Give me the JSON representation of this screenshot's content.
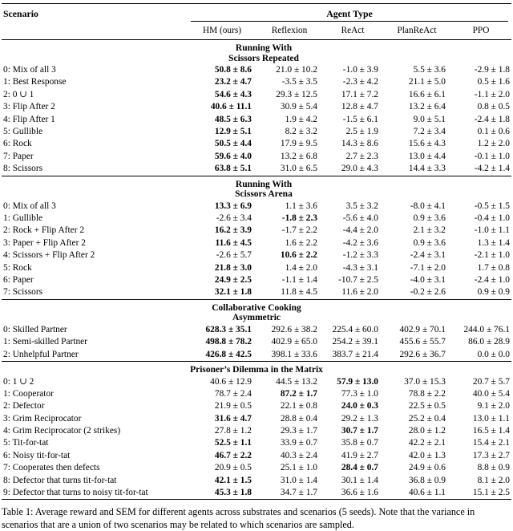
{
  "table": {
    "header": {
      "scenario_label": "Scenario",
      "group_label": "Agent Type",
      "columns": [
        "HM (ours)",
        "Reflexion",
        "ReAct",
        "PlanReAct",
        "PPO"
      ]
    },
    "sections": [
      {
        "title_line1": "Running With",
        "title_line2": "Scissors Repeated",
        "rows": [
          {
            "label": "0: Mix of all 3",
            "values": [
              "50.8 ± 8.6",
              "21.0 ± 10.2",
              "-1.0 ± 3.9",
              "5.5 ± 3.6",
              "-2.9 ± 1.8"
            ],
            "bold": [
              true,
              false,
              false,
              false,
              false
            ]
          },
          {
            "label": "1: Best Response",
            "values": [
              "23.2 ± 4.7",
              "-3.5 ± 3.5",
              "-2.3 ± 4.2",
              "21.1 ± 5.0",
              "0.5 ± 1.6"
            ],
            "bold": [
              true,
              false,
              false,
              false,
              false
            ]
          },
          {
            "label": "2: 0 ∪ 1",
            "values": [
              "54.6 ± 4.3",
              "29.3 ± 12.5",
              "17.1 ± 7.2",
              "16.6 ± 6.1",
              "-1.1 ± 2.0"
            ],
            "bold": [
              true,
              false,
              false,
              false,
              false
            ]
          },
          {
            "label": "3: Flip After 2",
            "values": [
              "40.6 ± 11.1",
              "30.9 ± 5.4",
              "12.8 ± 4.7",
              "13.2 ± 6.4",
              "0.8 ± 0.5"
            ],
            "bold": [
              true,
              false,
              false,
              false,
              false
            ]
          },
          {
            "label": "4: Flip After 1",
            "values": [
              "48.5 ± 6.3",
              "1.9 ± 4.2",
              "-1.5 ± 6.1",
              "9.0 ± 5.1",
              "-2.4 ± 1.8"
            ],
            "bold": [
              true,
              false,
              false,
              false,
              false
            ]
          },
          {
            "label": "5: Gullible",
            "values": [
              "12.9 ± 5.1",
              "8.2 ± 3.2",
              "2.5 ± 1.9",
              "7.2 ± 3.4",
              "0.1 ± 0.6"
            ],
            "bold": [
              true,
              false,
              false,
              false,
              false
            ]
          },
          {
            "label": "6: Rock",
            "values": [
              "50.5 ± 4.4",
              "17.9 ± 9.5",
              "14.3 ± 8.6",
              "15.6 ± 4.3",
              "1.2 ± 2.0"
            ],
            "bold": [
              true,
              false,
              false,
              false,
              false
            ]
          },
          {
            "label": "7: Paper",
            "values": [
              "59.6 ± 4.0",
              "13.2 ± 6.8",
              "2.7 ± 2.3",
              "13.0 ± 4.4",
              "-0.1 ± 1.0"
            ],
            "bold": [
              true,
              false,
              false,
              false,
              false
            ]
          },
          {
            "label": "8: Scissors",
            "values": [
              "63.8 ± 5.1",
              "31.0 ± 6.5",
              "29.0 ± 4.3",
              "14.4 ± 3.3",
              "-4.2 ± 1.4"
            ],
            "bold": [
              true,
              false,
              false,
              false,
              false
            ]
          }
        ]
      },
      {
        "title_line1": "Running With",
        "title_line2": "Scissors Arena",
        "rows": [
          {
            "label": "0: Mix of all 3",
            "values": [
              "13.3 ± 6.9",
              "1.1 ± 3.6",
              "3.5 ± 3.2",
              "-8.0 ± 4.1",
              "-0.5 ± 1.5"
            ],
            "bold": [
              true,
              false,
              false,
              false,
              false
            ]
          },
          {
            "label": "1: Gullible",
            "values": [
              "-2.6 ± 3.4",
              "-1.8 ± 2.3",
              "-5.6 ± 4.0",
              "0.9 ± 3.6",
              "-0.4 ± 1.0"
            ],
            "bold": [
              false,
              true,
              false,
              false,
              false
            ]
          },
          {
            "label": "2: Rock + Flip After 2",
            "values": [
              "16.2 ± 3.9",
              "-1.7 ± 2.2",
              "-4.4 ± 2.0",
              "2.1 ± 3.2",
              "-1.0 ± 1.1"
            ],
            "bold": [
              true,
              false,
              false,
              false,
              false
            ]
          },
          {
            "label": "3: Paper + Flip After 2",
            "values": [
              "11.6 ± 4.5",
              "1.6 ± 2.2",
              "-4.2 ± 3.6",
              "0.9 ± 3.6",
              "1.3 ± 1.4"
            ],
            "bold": [
              true,
              false,
              false,
              false,
              false
            ]
          },
          {
            "label": "4: Scissors + Flip After 2",
            "values": [
              "-2.6 ± 5.7",
              "10.6 ± 2.2",
              "-1.2 ± 3.3",
              "-2.4 ± 3.1",
              "-2.1 ± 1.0"
            ],
            "bold": [
              false,
              true,
              false,
              false,
              false
            ]
          },
          {
            "label": "5: Rock",
            "values": [
              "21.8 ± 3.0",
              "1.4 ± 2.0",
              "-4.3 ± 3.1",
              "-7.1 ± 2.0",
              "1.7 ± 0.8"
            ],
            "bold": [
              true,
              false,
              false,
              false,
              false
            ]
          },
          {
            "label": "6: Paper",
            "values": [
              "24.9 ± 2.5",
              "-1.1 ± 1.4",
              "-10.7 ± 2.5",
              "-4.0 ± 3.1",
              "-2.4 ± 1.0"
            ],
            "bold": [
              true,
              false,
              false,
              false,
              false
            ]
          },
          {
            "label": "7: Scissors",
            "values": [
              "32.1 ± 1.8",
              "11.8 ± 4.5",
              "11.6 ± 2.0",
              "-0.2 ± 2.6",
              "0.9 ± 0.9"
            ],
            "bold": [
              true,
              false,
              false,
              false,
              false
            ]
          }
        ]
      },
      {
        "title_line1": "Collaborative Cooking",
        "title_line2": "Asymmetric",
        "rows": [
          {
            "label": "0: Skilled Partner",
            "values": [
              "628.3 ± 35.1",
              "292.6 ± 38.2",
              "225.4 ± 60.0",
              "402.9 ± 70.1",
              "244.0 ± 76.1"
            ],
            "bold": [
              true,
              false,
              false,
              false,
              false
            ]
          },
          {
            "label": "1: Semi-skilled Partner",
            "values": [
              "498.8 ± 78.2",
              "402.9 ± 65.0",
              "254.2 ± 39.1",
              "455.6 ± 55.7",
              "86.0 ± 28.9"
            ],
            "bold": [
              true,
              false,
              false,
              false,
              false
            ]
          },
          {
            "label": "2: Unhelpful Partner",
            "values": [
              "426.8 ± 42.5",
              "398.1 ± 33.6",
              "383.7 ± 21.4",
              "292.6 ± 36.7",
              "0.0 ± 0.0"
            ],
            "bold": [
              true,
              false,
              false,
              false,
              false
            ]
          }
        ]
      },
      {
        "title_line1": "Prisoner’s Dilemma in the Matrix",
        "title_line2": "",
        "rows": [
          {
            "label": "0: 1 ∪ 2",
            "values": [
              "40.6 ± 12.9",
              "44.5 ± 13.2",
              "57.9 ± 13.0",
              "37.0 ± 15.3",
              "20.7 ± 5.7"
            ],
            "bold": [
              false,
              false,
              true,
              false,
              false
            ]
          },
          {
            "label": "1: Cooperator",
            "values": [
              "78.7 ± 2.4",
              "87.2 ± 1.7",
              "77.3 ± 1.0",
              "78.8 ± 2.2",
              "40.0 ± 5.4"
            ],
            "bold": [
              false,
              true,
              false,
              false,
              false
            ]
          },
          {
            "label": "2: Defector",
            "values": [
              "21.9 ± 0.5",
              "22.1 ± 0.8",
              "24.0 ± 0.3",
              "22.5 ± 0.5",
              "9.1 ± 2.0"
            ],
            "bold": [
              false,
              false,
              true,
              false,
              false
            ]
          },
          {
            "label": "3: Grim Reciprocator",
            "values": [
              "31.6 ± 4.7",
              "28.8 ± 0.4",
              "29.2 ± 1.3",
              "25.2 ± 0.4",
              "13.0 ± 1.1"
            ],
            "bold": [
              true,
              false,
              false,
              false,
              false
            ]
          },
          {
            "label": "4: Grim Reciprocator (2 strikes)",
            "values": [
              "27.8 ± 1.2",
              "29.3 ± 1.7",
              "30.7 ± 1.7",
              "28.0 ± 1.2",
              "16.5 ± 1.4"
            ],
            "bold": [
              false,
              false,
              true,
              false,
              false
            ]
          },
          {
            "label": "5: Tit-for-tat",
            "values": [
              "52.5 ± 1.1",
              "33.9 ± 0.7",
              "35.8 ± 0.7",
              "42.2 ± 2.1",
              "15.4 ± 2.1"
            ],
            "bold": [
              true,
              false,
              false,
              false,
              false
            ]
          },
          {
            "label": "6: Noisy tit-for-tat",
            "values": [
              "46.7 ± 2.2",
              "40.3 ± 2.4",
              "41.9 ± 2.7",
              "42.0 ± 1.3",
              "17.3 ± 2.7"
            ],
            "bold": [
              true,
              false,
              false,
              false,
              false
            ]
          },
          {
            "label": "7: Cooperates then defects",
            "values": [
              "20.9 ± 0.5",
              "25.1 ± 1.0",
              "28.4 ± 0.7",
              "24.9 ± 0.6",
              "8.8 ± 0.9"
            ],
            "bold": [
              false,
              false,
              true,
              false,
              false
            ]
          },
          {
            "label": "8: Defector that turns tit-for-tat",
            "values": [
              "42.1 ± 1.5",
              "31.0 ± 1.4",
              "30.1 ± 1.4",
              "36.8 ± 0.9",
              "8.1 ± 2.0"
            ],
            "bold": [
              true,
              false,
              false,
              false,
              false
            ]
          },
          {
            "label": "9: Defector that turns to noisy tit-for-tat",
            "values": [
              "45.3 ± 1.8",
              "34.7 ± 1.7",
              "36.6 ± 1.6",
              "40.6 ± 1.1",
              "15.1 ± 2.5"
            ],
            "bold": [
              true,
              false,
              false,
              false,
              false
            ]
          }
        ]
      }
    ]
  },
  "caption": {
    "line1": "Table 1: Average reward and SEM for different agents across substrates and scenarios (5 seeds). Note",
    "line2": "that the variance in scenarios that are a union of two scenarios may be related to which scenarios",
    "line3": "are sampled."
  }
}
